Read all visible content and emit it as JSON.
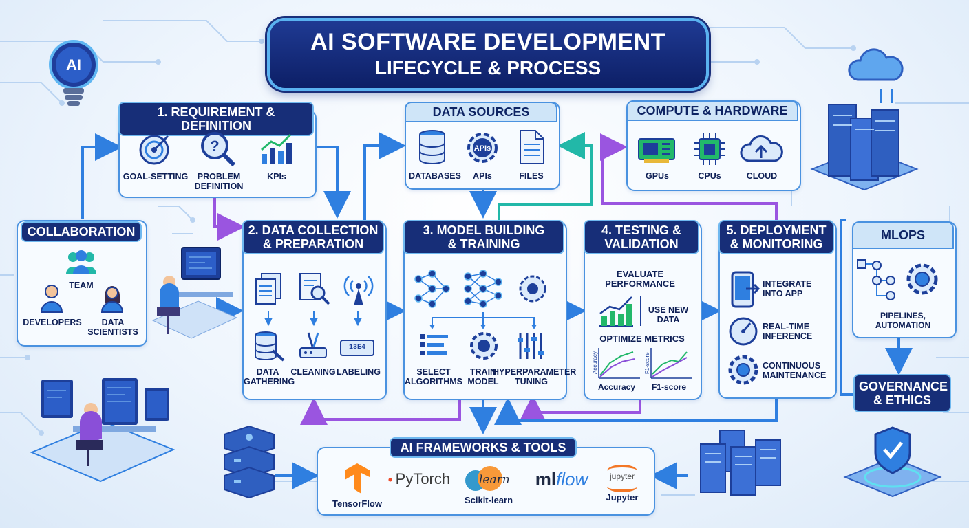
{
  "title": {
    "line1": "AI SOFTWARE DEVELOPMENT",
    "line2": "LIFECYCLE & PROCESS"
  },
  "ai_badge": "AI",
  "requirement": {
    "title": "1. REQUIREMENT & DEFINITION",
    "items": [
      "GOAL-SETTING",
      "PROBLEM\nDEFINITION",
      "KPIs"
    ]
  },
  "data_sources": {
    "title": "DATA SOURCES",
    "items": [
      "DATABASES",
      "APIs",
      "FILES"
    ],
    "api_icon_text": "APIs"
  },
  "compute": {
    "title": "COMPUTE & HARDWARE",
    "items": [
      "GPUs",
      "CPUs",
      "CLOUD"
    ]
  },
  "collaboration": {
    "title": "COLLABORATION",
    "items": [
      "TEAM",
      "DEVELOPERS",
      "DATA\nSCIENTISTS"
    ]
  },
  "data_collection": {
    "title": "2. DATA COLLECTION\n& PREPARATION",
    "items": [
      "DATA\nGATHERING",
      "CLEANING",
      "LABELING"
    ],
    "label_tag": "13E4"
  },
  "model_building": {
    "title": "3. MODEL BUILDING\n& TRAINING",
    "items": [
      "SELECT\nALGORITHMS",
      "TRAIN\nMODEL",
      "HYPERPARAMETER\nTUNING"
    ]
  },
  "testing": {
    "title": "4. TESTING &\nVALIDATION",
    "evaluate": "EVALUATE\nPERFORMANCE",
    "use_new_data": "USE NEW\nDATA",
    "optimize": "OPTIMIZE METRICS",
    "chart_labels": [
      "Accuracy",
      "F1-score"
    ],
    "axis_labels": [
      "Accuracy",
      "F1-score"
    ]
  },
  "deployment": {
    "title": "5. DEPLOYMENT\n& MONITORING",
    "items": [
      "INTEGRATE\nINTO APP",
      "REAL-TIME\nINFERENCE",
      "CONTINUOUS\nMAINTENANCE"
    ]
  },
  "mlops": {
    "title": "MLOPS",
    "caption": "PIPELINES, AUTOMATION"
  },
  "governance": {
    "title": "GOVERNANCE\n& ETHICS"
  },
  "frameworks": {
    "title": "AI FRAMEWORKS & TOOLS",
    "tools": [
      {
        "logo": "PyTorch",
        "caption": "TensorFlow"
      },
      {
        "logo": "learn",
        "caption": "Scikit-learn"
      },
      {
        "logo_ml": "ml",
        "logo_flow": "flow",
        "caption": ""
      },
      {
        "logo": "jupyter",
        "caption": "Jupyter"
      }
    ]
  },
  "colors": {
    "navy": "#172e78",
    "accent_blue": "#2f7fe0",
    "purple": "#9a55e0",
    "teal": "#22b8a8",
    "panel_border": "#4a92e0"
  }
}
